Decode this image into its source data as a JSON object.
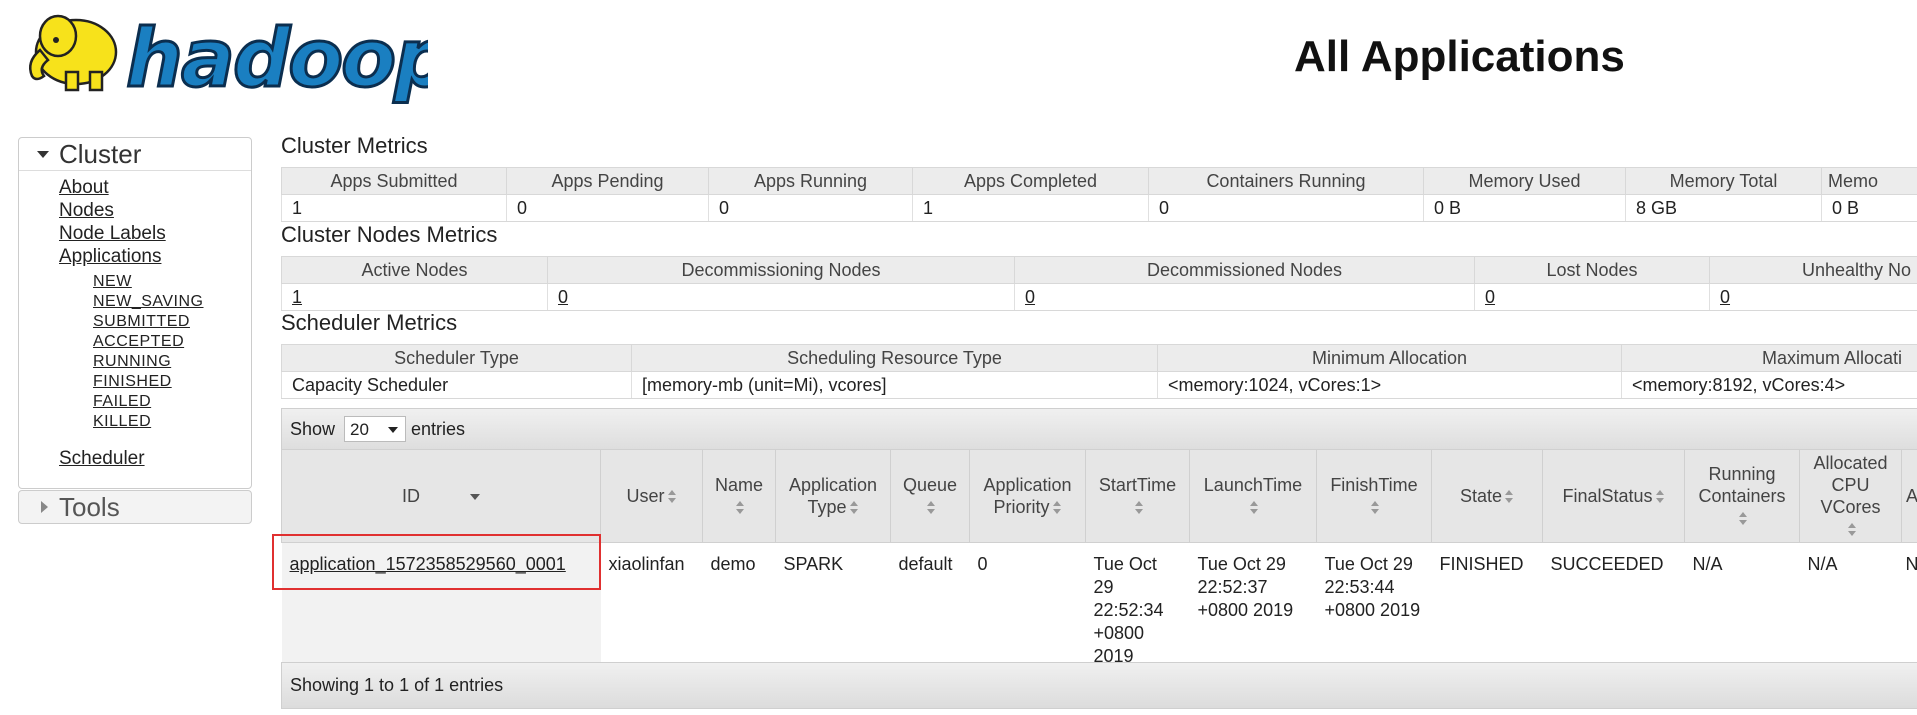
{
  "header": {
    "logo_text": "hadoop",
    "title": "All Applications"
  },
  "sidebar": {
    "cluster": {
      "label": "Cluster",
      "links": [
        "About",
        "Nodes",
        "Node Labels",
        "Applications"
      ],
      "app_states": [
        "NEW",
        "NEW_SAVING",
        "SUBMITTED",
        "ACCEPTED",
        "RUNNING",
        "FINISHED",
        "FAILED",
        "KILLED"
      ],
      "scheduler": "Scheduler"
    },
    "tools": {
      "label": "Tools"
    }
  },
  "cluster_metrics": {
    "title": "Cluster Metrics",
    "headers": [
      "Apps Submitted",
      "Apps Pending",
      "Apps Running",
      "Apps Completed",
      "Containers Running",
      "Memory Used",
      "Memory Total",
      "Memo"
    ],
    "values": [
      "1",
      "0",
      "0",
      "1",
      "0",
      "0 B",
      "8 GB",
      "0 B"
    ]
  },
  "cluster_nodes_metrics": {
    "title": "Cluster Nodes Metrics",
    "headers": [
      "Active Nodes",
      "Decommissioning Nodes",
      "Decommissioned Nodes",
      "Lost Nodes",
      "Unhealthy No"
    ],
    "values": [
      "1",
      "0",
      "0",
      "0",
      "0"
    ]
  },
  "scheduler_metrics": {
    "title": "Scheduler Metrics",
    "headers": [
      "Scheduler Type",
      "Scheduling Resource Type",
      "Minimum Allocation",
      "Maximum Allocati"
    ],
    "values": [
      "Capacity Scheduler",
      "[memory-mb (unit=Mi), vcores]",
      "<memory:1024, vCores:1>",
      "<memory:8192, vCores:4>"
    ]
  },
  "apps_table": {
    "show_label": "Show",
    "page_length": "20",
    "entries_label": "entries",
    "headers": [
      "ID",
      "User",
      "Name",
      "Application Type",
      "Queue",
      "Application Priority",
      "StartTime",
      "LaunchTime",
      "FinishTime",
      "State",
      "FinalStatus",
      "Running Containers",
      "Allocated CPU VCores",
      "A"
    ],
    "row": {
      "id": "application_1572358529560_0001",
      "user": "xiaolinfan",
      "name": "demo",
      "type": "SPARK",
      "queue": "default",
      "priority": "0",
      "start": "Tue Oct 29 22:52:34 +0800 2019",
      "launch": "Tue Oct 29 22:52:37 +0800 2019",
      "finish": "Tue Oct 29 22:53:44 +0800 2019",
      "state": "FINISHED",
      "final_status": "SUCCEEDED",
      "running_containers": "N/A",
      "allocated_vcores": "N/A",
      "next": "N"
    },
    "footer": "Showing 1 to 1 of 1 entries"
  },
  "colors": {
    "highlight": "#e03030",
    "logo_blue": "#1a7fc1",
    "logo_yellow": "#f7e21b"
  }
}
